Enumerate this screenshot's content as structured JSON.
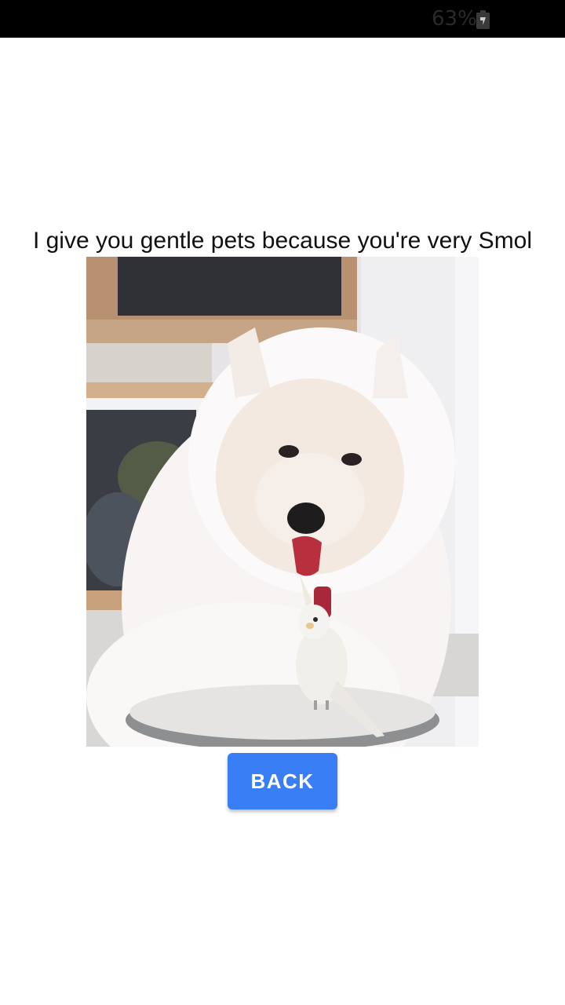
{
  "status_bar": {
    "battery_percent": "63%",
    "battery_glyph": "⚡",
    "battery_icon": "battery-charging-icon"
  },
  "main": {
    "caption": "I give you gentle pets because you're very Smol",
    "image_icon": "dog-and-bird-photo",
    "back_button_label": "BACK"
  },
  "colors": {
    "status_bar_bg": "#000000",
    "button_bg": "#3a7ef6",
    "button_text": "#ffffff",
    "page_bg": "#ffffff"
  }
}
